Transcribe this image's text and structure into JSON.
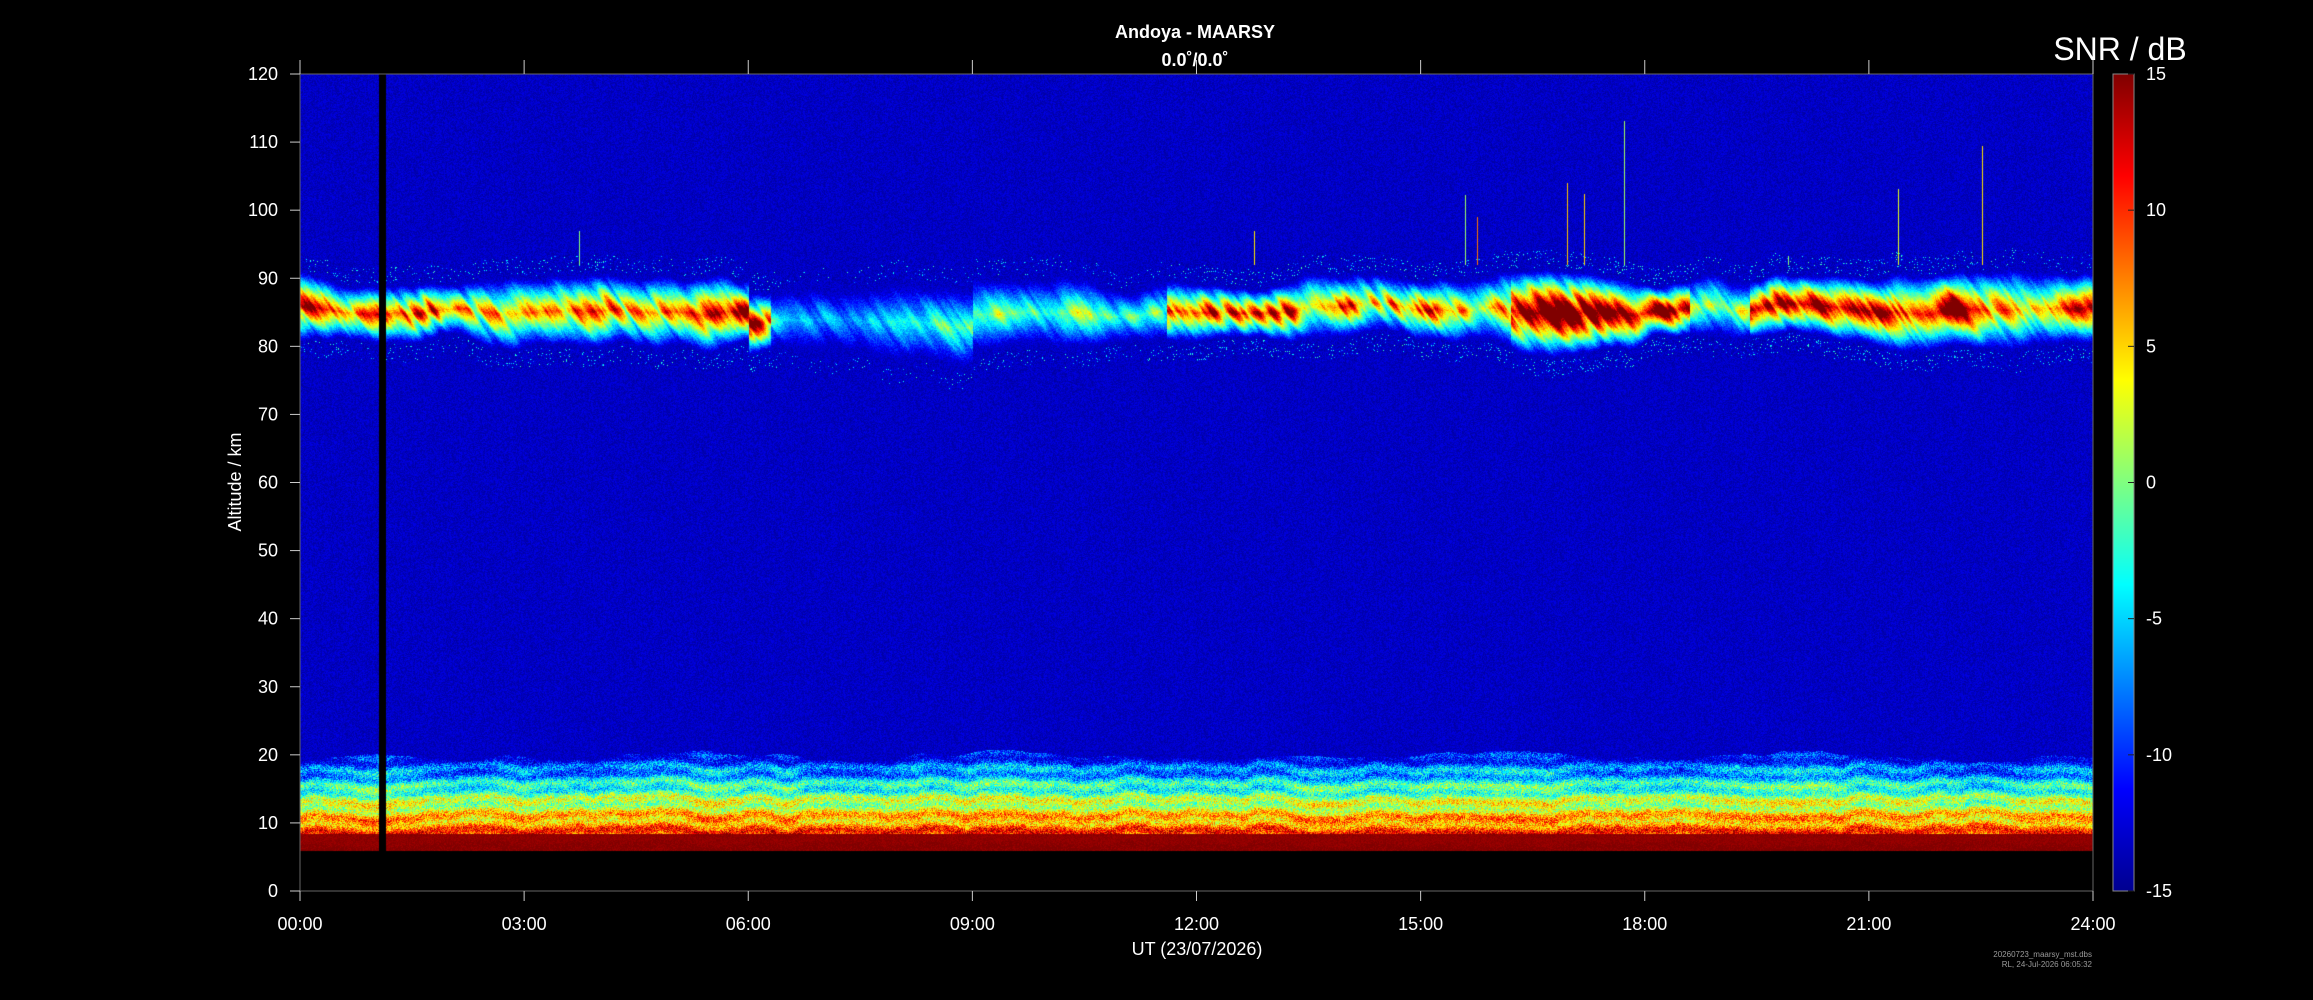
{
  "chart_data": {
    "type": "heatmap",
    "title": "Andoya - MAARSY",
    "subtitle": "0.0˚/0.0˚",
    "xlabel": "UT (23/07/2026)",
    "ylabel": "Altitude / km",
    "colorbar_label": "SNR / dB",
    "x_ticks": [
      "00:00",
      "03:00",
      "06:00",
      "09:00",
      "12:00",
      "15:00",
      "18:00",
      "21:00",
      "24:00"
    ],
    "xlim_hours": [
      0,
      24
    ],
    "y_ticks": [
      0,
      10,
      20,
      30,
      40,
      50,
      60,
      70,
      80,
      90,
      100,
      110,
      120
    ],
    "ylim": [
      0,
      120
    ],
    "data_altitude_range_km": [
      6,
      120
    ],
    "colorbar_ticks": [
      15,
      10,
      5,
      0,
      -5,
      -10,
      -15
    ],
    "clim": [
      -15,
      15
    ],
    "colormap": "jet",
    "background_snr_db": -13,
    "data_gap_hour": 1.1,
    "pmse_layer_km": [
      80,
      92
    ],
    "troposphere_echo_km": [
      6,
      22
    ],
    "footer": [
      "20260723_maarsy_mst.dbs",
      "RL, 24-Jul-2026 06:05:32"
    ]
  }
}
